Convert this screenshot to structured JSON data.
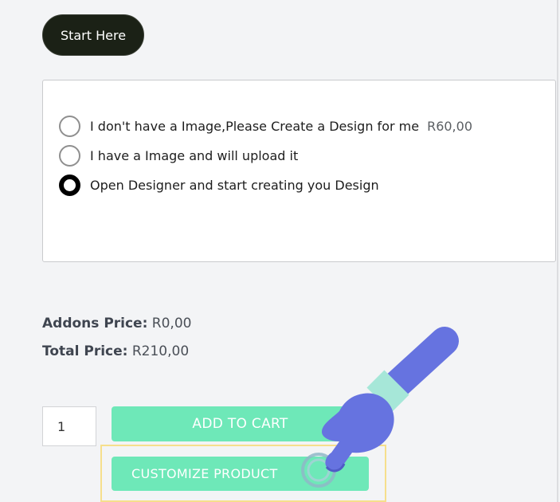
{
  "start_button": {
    "label": "Start Here"
  },
  "options": [
    {
      "label": "I don't have a Image,Please Create a Design for me",
      "price": "R60,00",
      "checked": false
    },
    {
      "label": "I have a Image and will upload it",
      "price": "",
      "checked": false
    },
    {
      "label": "Open Designer and start creating you Design",
      "price": "",
      "checked": true
    }
  ],
  "pricing": {
    "addons_label": "Addons Price:",
    "addons_value": "R0,00",
    "total_label": "Total Price:",
    "total_value": "R210,00"
  },
  "cart": {
    "quantity": "1",
    "add_to_cart_label": "ADD TO CART",
    "customize_label": "CUSTOMIZE PRODUCT"
  },
  "colors": {
    "accent_button": "#6ee8b8",
    "dark_button": "#1b2116",
    "highlight_border": "#f6df8c",
    "hand": "#6673e0"
  },
  "icons": {
    "pointer": "pointing-hand-icon"
  }
}
